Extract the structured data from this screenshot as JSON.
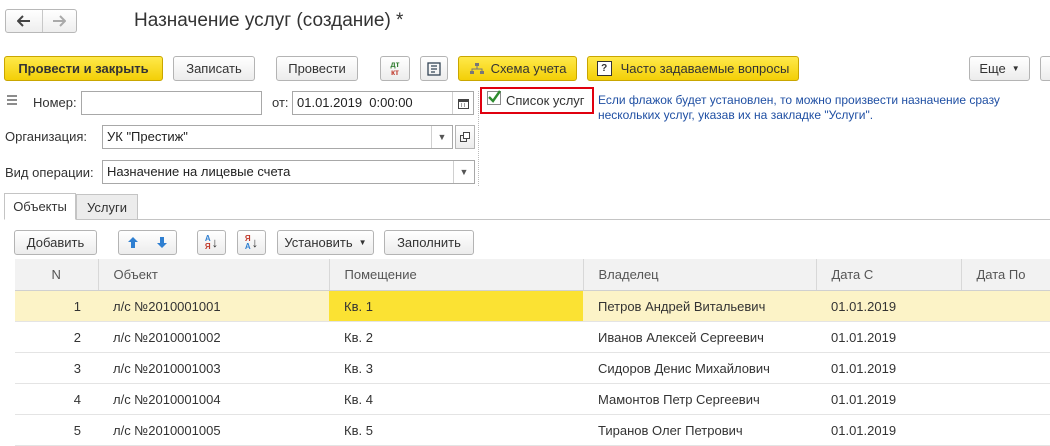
{
  "title": "Назначение услуг (создание) *",
  "toolbar": {
    "post_close": "Провести и закрыть",
    "save": "Записать",
    "post": "Провести",
    "dtkt_top": "дт",
    "dtkt_bottom": "кт",
    "scheme": "Схема учета",
    "faq": "Часто задаваемые вопросы",
    "more": "Еще"
  },
  "header": {
    "number_label": "Номер:",
    "number_value": "",
    "from_label": "от:",
    "date_value": "01.01.2019  0:00:00",
    "services_list_label": "Список услуг",
    "services_list_checked": true,
    "hint": "Если флажок будет установлен, то можно произвести назначение сразу нескольких услуг, указав их на закладке \"Услуги\".",
    "org_label": "Организация:",
    "org_value": "УК \"Престиж\"",
    "op_label": "Вид операции:",
    "op_value": "Назначение на лицевые счета"
  },
  "tabs": [
    {
      "label": "Объекты",
      "active": true
    },
    {
      "label": "Услуги",
      "active": false
    }
  ],
  "table_toolbar": {
    "add": "Добавить",
    "set": "Установить",
    "fill": "Заполнить"
  },
  "table": {
    "columns": [
      "N",
      "Объект",
      "Помещение",
      "Владелец",
      "Дата С",
      "Дата По"
    ],
    "rows": [
      {
        "n": "1",
        "object": "л/с №2010001001",
        "room": "Кв. 1",
        "owner": "Петров Андрей Витальевич",
        "date_from": "01.01.2019",
        "date_to": ""
      },
      {
        "n": "2",
        "object": "л/с №2010001002",
        "room": "Кв. 2",
        "owner": "Иванов Алексей Сергеевич",
        "date_from": "01.01.2019",
        "date_to": ""
      },
      {
        "n": "3",
        "object": "л/с №2010001003",
        "room": "Кв. 3",
        "owner": "Сидоров Денис Михайлович",
        "date_from": "01.01.2019",
        "date_to": ""
      },
      {
        "n": "4",
        "object": "л/с №2010001004",
        "room": "Кв. 4",
        "owner": "Мамонтов Петр Сергеевич",
        "date_from": "01.01.2019",
        "date_to": ""
      },
      {
        "n": "5",
        "object": "л/с №2010001005",
        "room": "Кв. 5",
        "owner": "Тиранов Олег Петрович",
        "date_from": "01.01.2019",
        "date_to": ""
      }
    ]
  },
  "colors": {
    "accent_yellow": "#f6d80c",
    "highlight_red": "#e0000f",
    "hint_blue": "#1f4fa3"
  }
}
